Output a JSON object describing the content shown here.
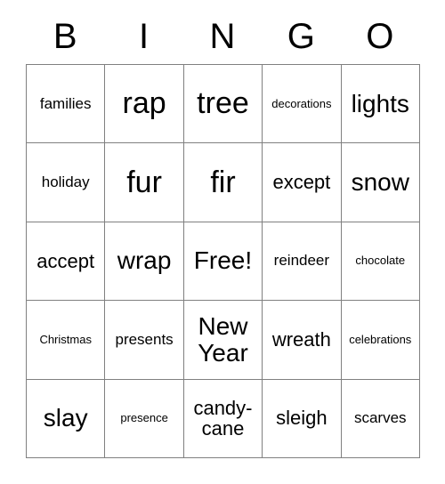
{
  "card": {
    "title": "BINGO",
    "headers": [
      "B",
      "I",
      "N",
      "G",
      "O"
    ],
    "free_space_label": "Free!",
    "colors": {
      "border": "#808080",
      "background": "#ffffff",
      "text": "#000000"
    },
    "rows": [
      [
        {
          "text": "families",
          "size": "sm"
        },
        {
          "text": "rap",
          "size": "xl"
        },
        {
          "text": "tree",
          "size": "xl"
        },
        {
          "text": "decorations",
          "size": "xs"
        },
        {
          "text": "lights",
          "size": "lg"
        }
      ],
      [
        {
          "text": "holiday",
          "size": "sm"
        },
        {
          "text": "fur",
          "size": "xl"
        },
        {
          "text": "fir",
          "size": "xl"
        },
        {
          "text": "except",
          "size": "md"
        },
        {
          "text": "snow",
          "size": "lg"
        }
      ],
      [
        {
          "text": "accept",
          "size": "md"
        },
        {
          "text": "wrap",
          "size": "lg"
        },
        {
          "text": "Free!",
          "size": "lg"
        },
        {
          "text": "reindeer",
          "size": "sm"
        },
        {
          "text": "chocolate",
          "size": "xs"
        }
      ],
      [
        {
          "text": "Christmas",
          "size": "xs"
        },
        {
          "text": "presents",
          "size": "sm"
        },
        {
          "text": "New Year",
          "size": "lg"
        },
        {
          "text": "wreath",
          "size": "md"
        },
        {
          "text": "celebrations",
          "size": "xs"
        }
      ],
      [
        {
          "text": "slay",
          "size": "lg"
        },
        {
          "text": "presence",
          "size": "xs"
        },
        {
          "text": "candy-cane",
          "size": "md"
        },
        {
          "text": "sleigh",
          "size": "md"
        },
        {
          "text": "scarves",
          "size": "sm"
        }
      ]
    ]
  }
}
